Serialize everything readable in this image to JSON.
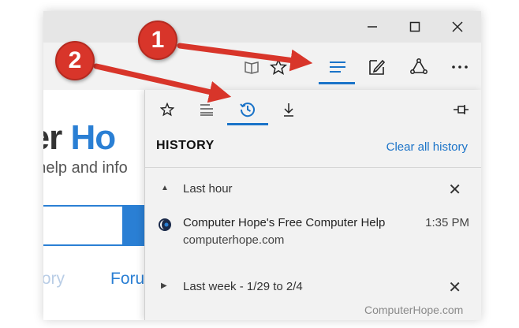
{
  "window": {
    "minimize_icon": "minimize-icon",
    "maximize_icon": "maximize-icon",
    "close_icon": "close-icon"
  },
  "toolbar": {
    "buttons": [
      "reading-view-icon",
      "favorite-star-icon",
      "hub-icon",
      "web-note-icon",
      "share-icon",
      "more-icon"
    ]
  },
  "page": {
    "brand_dark": "ter ",
    "brand_blue": "Ho",
    "tagline": "r help and info",
    "nav_left": "tory",
    "nav_right": "Foru"
  },
  "hub": {
    "tabs": [
      "favorites-icon",
      "reading-list-icon",
      "history-icon",
      "downloads-icon"
    ],
    "active_tab": "history",
    "title": "HISTORY",
    "clear_all": "Clear all history",
    "groups": [
      {
        "label": "Last hour",
        "expanded": true,
        "items": [
          {
            "title": "Computer Hope's Free Computer Help",
            "url": "computerhope.com",
            "time": "1:35 PM"
          }
        ]
      },
      {
        "label": "Last week - 1/29 to 2/4",
        "expanded": false,
        "items": []
      }
    ]
  },
  "annotations": {
    "badge_1": "1",
    "badge_2": "2",
    "color": "#d8352a"
  },
  "watermark": "ComputerHope.com",
  "colors": {
    "accent": "#1a73c8",
    "brand_blue": "#2a7fd4"
  }
}
